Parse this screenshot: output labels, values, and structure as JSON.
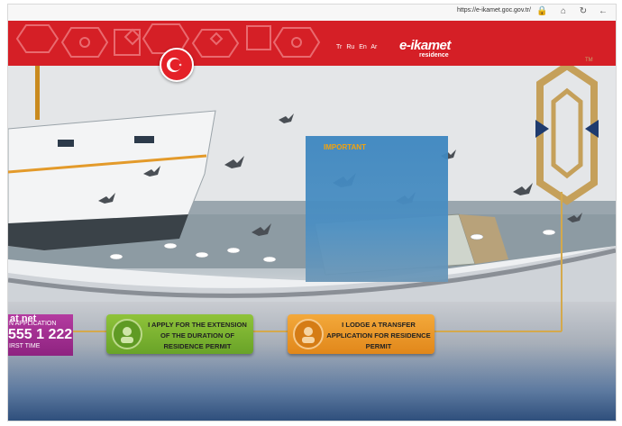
{
  "browser": {
    "url": "https://e-ikamet.goc.gov.tr/"
  },
  "header": {
    "languages": [
      "Tr",
      "Ru",
      "En",
      "Ar"
    ],
    "logo_main": "e-ikamet",
    "logo_sub": "residence",
    "trademark": "TM"
  },
  "important_panel": {
    "title": "IMPORTANT"
  },
  "left_banner": {
    "line1": "at net",
    "line2": "N APPLICATION",
    "line3": "555 1 222",
    "line4": "IRST TIME"
  },
  "actions": [
    {
      "label": "I APPLY FOR THE EXTENSION OF THE DURATION OF RESIDENCE PERMIT"
    },
    {
      "label": "I LODGE A TRANSFER APPLICATION FOR RESIDENCE PERMIT"
    }
  ],
  "colors": {
    "header_red": "#d51f26",
    "green_button": "#7cb432",
    "orange_button": "#eb9a2a",
    "gold": "#c5a05a",
    "important_blue": "#4b8fc3",
    "important_title": "#f5a000"
  }
}
